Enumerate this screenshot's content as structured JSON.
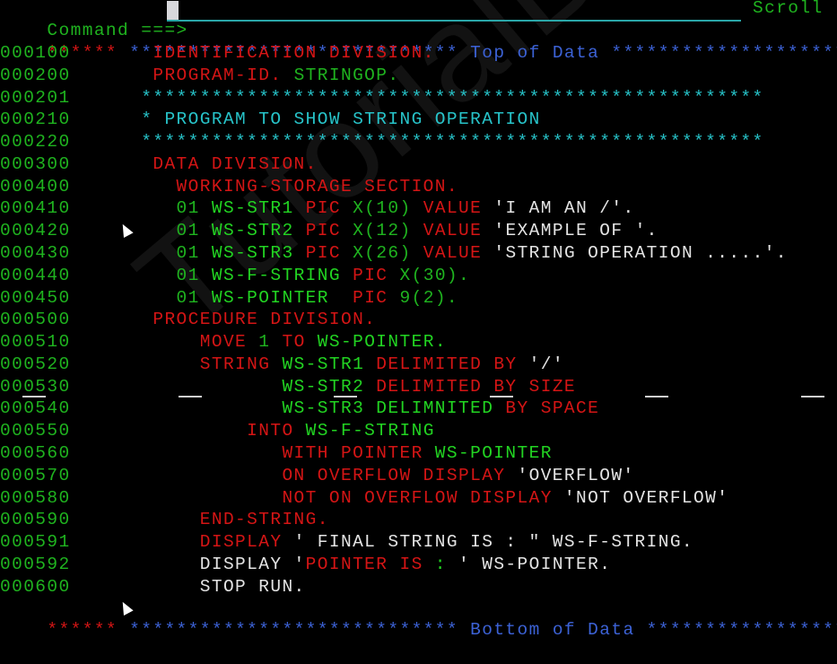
{
  "window": {
    "app": "ISPF Editor"
  },
  "command": {
    "prompt": "Command ===>",
    "value": "",
    "scroll_label": "Scroll"
  },
  "banners": {
    "top": {
      "prefix": "******",
      "stars_left": " ****************************",
      "label": " Top of Data ",
      "stars_right": "**********************"
    },
    "bottom": {
      "prefix": "******",
      "stars_left": " ****************************",
      "label": " Bottom of Data ",
      "stars_right": "********************"
    }
  },
  "lines": [
    {
      "num": "000100",
      "segments": [
        {
          "t": "       IDENTIFICATION DIVISION.",
          "c": "r"
        }
      ]
    },
    {
      "num": "000200",
      "segments": [
        {
          "t": "       PROGRAM-ID. ",
          "c": "r"
        },
        {
          "t": "STRINGOP.",
          "c": "g"
        }
      ]
    },
    {
      "num": "000201",
      "segments": [
        {
          "t": "      *****************************************************",
          "c": "c"
        }
      ]
    },
    {
      "num": "000210",
      "segments": [
        {
          "t": "      * PROGRAM TO SHOW STRING OPERATION",
          "c": "c"
        }
      ]
    },
    {
      "num": "000220",
      "segments": [
        {
          "t": "      *****************************************************",
          "c": "c"
        }
      ]
    },
    {
      "num": "000300",
      "segments": [
        {
          "t": "       DATA DIVISION.",
          "c": "r"
        }
      ]
    },
    {
      "num": "000400",
      "segments": [
        {
          "t": "         WORKING-STORAGE SECTION.",
          "c": "r"
        }
      ]
    },
    {
      "num": "000410",
      "segments": [
        {
          "t": "         01 ",
          "c": "g"
        },
        {
          "t": "WS-STR1 ",
          "c": "bg"
        },
        {
          "t": "PIC ",
          "c": "r"
        },
        {
          "t": "X(10) ",
          "c": "g"
        },
        {
          "t": "VALUE ",
          "c": "r"
        },
        {
          "t": "'I AM AN /'.",
          "c": "w"
        }
      ]
    },
    {
      "num": "000420",
      "segments": [
        {
          "t": "         01 ",
          "c": "g"
        },
        {
          "t": "WS-STR2 ",
          "c": "bg"
        },
        {
          "t": "PIC ",
          "c": "r"
        },
        {
          "t": "X(12) ",
          "c": "g"
        },
        {
          "t": "VALUE ",
          "c": "r"
        },
        {
          "t": "'EXAMPLE OF '.",
          "c": "w"
        }
      ]
    },
    {
      "num": "000430",
      "segments": [
        {
          "t": "         01 ",
          "c": "g"
        },
        {
          "t": "WS-STR3 ",
          "c": "bg"
        },
        {
          "t": "PIC ",
          "c": "r"
        },
        {
          "t": "X(26) ",
          "c": "g"
        },
        {
          "t": "VALUE ",
          "c": "r"
        },
        {
          "t": "'STRING OPERATION .....'.",
          "c": "w"
        }
      ]
    },
    {
      "num": "000440",
      "segments": [
        {
          "t": "         01 ",
          "c": "g"
        },
        {
          "t": "WS-F-STRING ",
          "c": "bg"
        },
        {
          "t": "PIC ",
          "c": "r"
        },
        {
          "t": "X(30).",
          "c": "g"
        }
      ]
    },
    {
      "num": "000450",
      "segments": [
        {
          "t": "         01 ",
          "c": "g"
        },
        {
          "t": "WS-POINTER  ",
          "c": "bg"
        },
        {
          "t": "PIC ",
          "c": "r"
        },
        {
          "t": "9(2).",
          "c": "g"
        }
      ]
    },
    {
      "num": "000500",
      "segments": [
        {
          "t": "       PROCEDURE DIVISION.",
          "c": "r"
        }
      ]
    },
    {
      "num": "000510",
      "segments": [
        {
          "t": "           MOVE ",
          "c": "r"
        },
        {
          "t": "1 ",
          "c": "g"
        },
        {
          "t": "TO ",
          "c": "r"
        },
        {
          "t": "WS-POINTER.",
          "c": "bg"
        }
      ]
    },
    {
      "num": "000520",
      "segments": [
        {
          "t": "           STRING ",
          "c": "r"
        },
        {
          "t": "WS-STR1 ",
          "c": "bg"
        },
        {
          "t": "DELIMITED BY ",
          "c": "r"
        },
        {
          "t": "'/'",
          "c": "w"
        }
      ]
    },
    {
      "num": "000530",
      "segments": [
        {
          "t": "                  ",
          "c": "g"
        },
        {
          "t": "WS-STR2 ",
          "c": "bg"
        },
        {
          "t": "DELIMITED BY SIZE",
          "c": "r"
        }
      ]
    },
    {
      "num": "000540",
      "segments": [
        {
          "t": "                  ",
          "c": "g"
        },
        {
          "t": "WS-STR3 DELIMNITED ",
          "c": "bg"
        },
        {
          "t": "BY SPACE",
          "c": "r"
        }
      ]
    },
    {
      "num": "000550",
      "segments": [
        {
          "t": "               INTO ",
          "c": "r"
        },
        {
          "t": "WS-F-STRING",
          "c": "bg"
        }
      ]
    },
    {
      "num": "000560",
      "segments": [
        {
          "t": "                  WITH POINTER ",
          "c": "r"
        },
        {
          "t": "WS-POINTER",
          "c": "bg"
        }
      ]
    },
    {
      "num": "000570",
      "segments": [
        {
          "t": "                  ON OVERFLOW DISPLAY ",
          "c": "r"
        },
        {
          "t": "'OVERFLOW'",
          "c": "w"
        }
      ]
    },
    {
      "num": "000580",
      "segments": [
        {
          "t": "                  NOT ON OVERFLOW DISPLAY ",
          "c": "r"
        },
        {
          "t": "'NOT OVERFLOW'",
          "c": "w"
        }
      ]
    },
    {
      "num": "000590",
      "segments": [
        {
          "t": "           END-STRING.",
          "c": "r"
        }
      ]
    },
    {
      "num": "000591",
      "segments": [
        {
          "t": "           DISPLAY ",
          "c": "r"
        },
        {
          "t": "' FINAL STRING IS : \" WS-F-STRING.",
          "c": "w"
        }
      ]
    },
    {
      "num": "000592",
      "segments": [
        {
          "t": "           DISPLAY '",
          "c": "w"
        },
        {
          "t": "POINTER IS ",
          "c": "r"
        },
        {
          "t": ": ",
          "c": "bg"
        },
        {
          "t": "' WS-POINTER.",
          "c": "w"
        }
      ]
    },
    {
      "num": "000600",
      "segments": [
        {
          "t": "           STOP RUN.",
          "c": "w"
        }
      ]
    }
  ],
  "watermark": "TutorialBrain"
}
